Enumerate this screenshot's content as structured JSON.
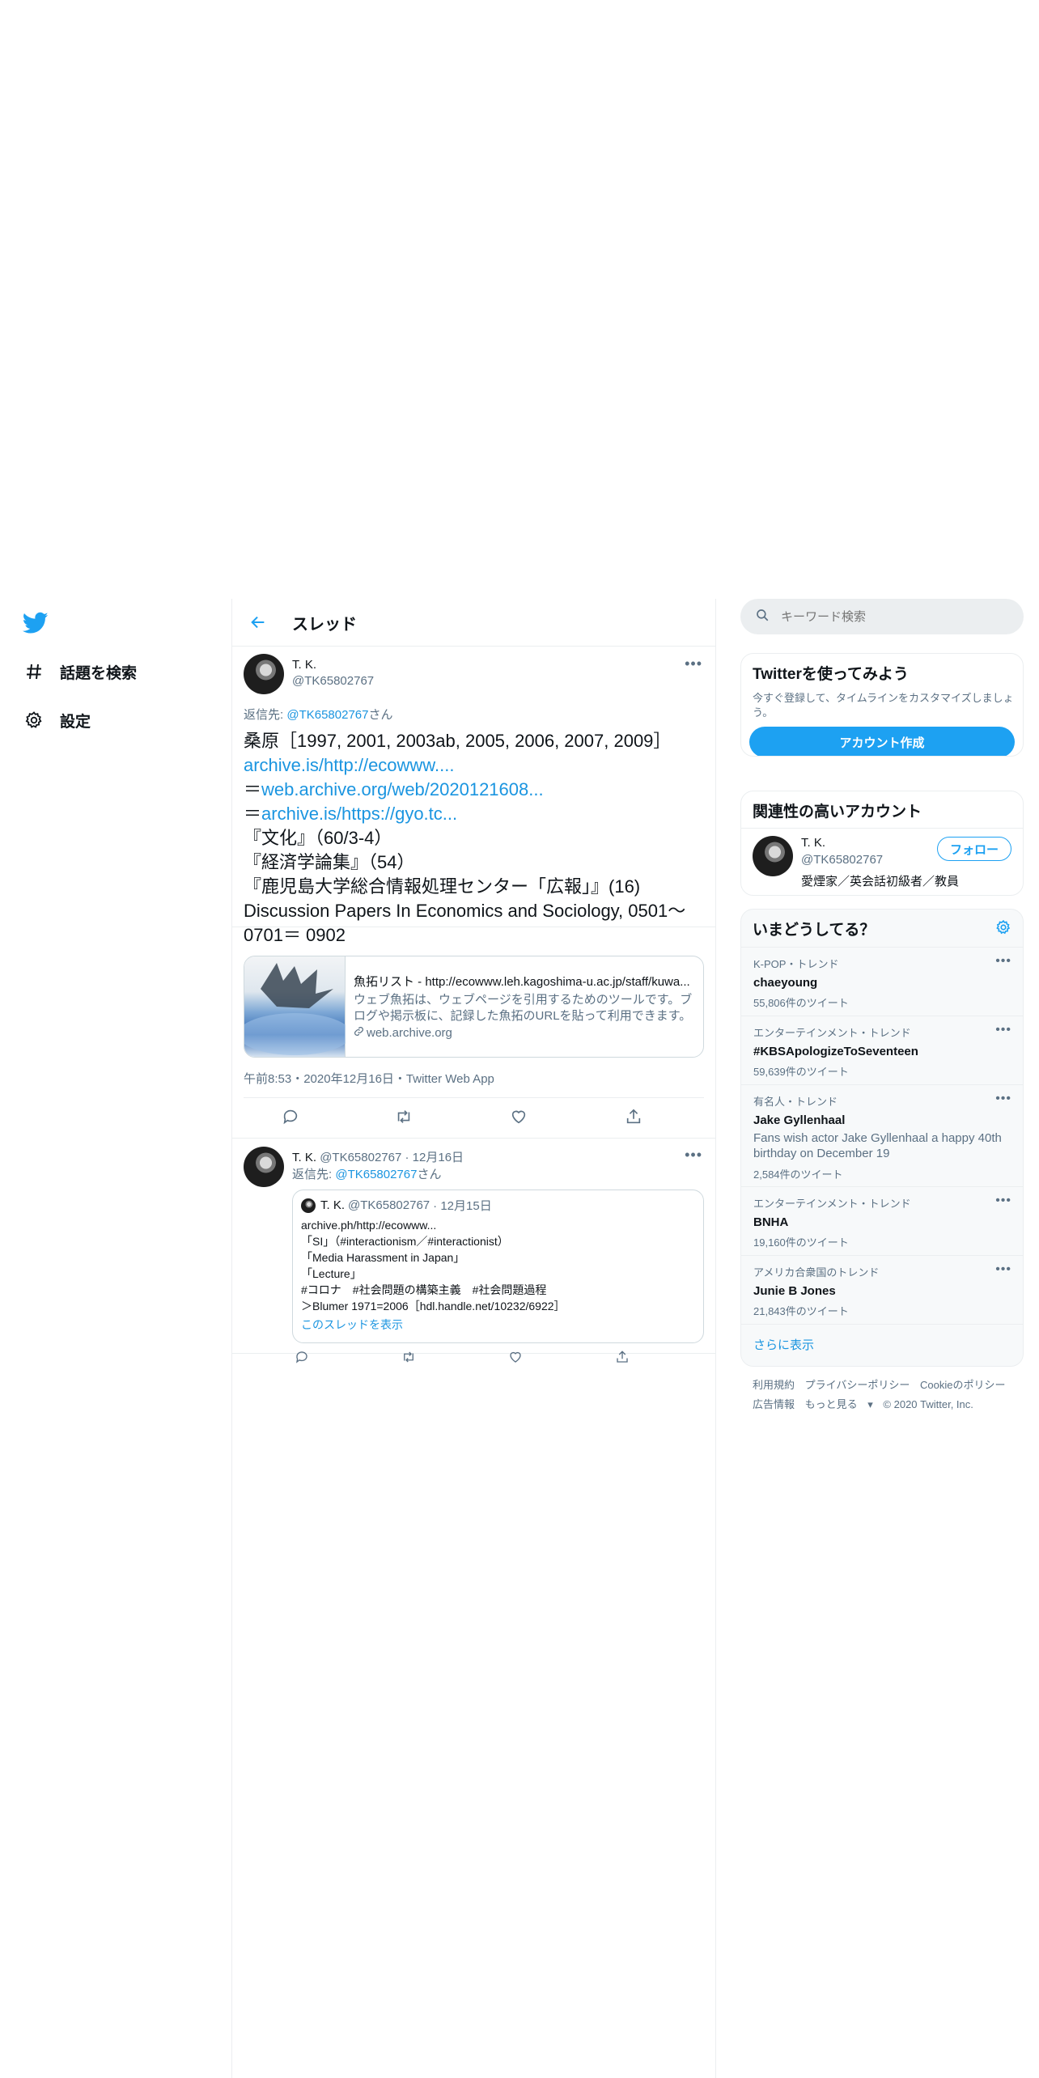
{
  "nav": {
    "explore_label": "話題を検索",
    "settings_label": "設定"
  },
  "header": {
    "title": "スレッド"
  },
  "main_tweet": {
    "name": "T. K.",
    "handle": "@TK65802767",
    "reply_prefix": "返信先: ",
    "reply_handle": "@TK65802767",
    "reply_suffix": "さん",
    "line1": "桑原［1997, 2001, 2003ab, 2005, 2006, 2007, 2009］",
    "link1": "archive.is/http://ecowww....",
    "line2_prefix": "＝",
    "link2": "web.archive.org/web/2020121608...",
    "line3_prefix": "＝",
    "link3": "archive.is/https://gyo.tc...",
    "line4": "『文化』（60/3-4）",
    "line5": "『経済学論集』（54）",
    "line6": "『鹿児島大学総合情報処理センター「広報」』(16)",
    "line7": "Discussion Papers In Economics and Sociology, 0501～ 0701＝ 0902",
    "card": {
      "title": "魚拓リスト - http://ecowww.leh.kagoshima-u.ac.jp/staff/kuwa...",
      "description": "ウェブ魚拓は、ウェブページを引用するためのツールです。ブログや掲示板に、記録した魚拓のURLを貼って利用できます。",
      "domain": "web.archive.org"
    },
    "timestamp": "午前8:53・2020年12月16日・Twitter Web App"
  },
  "reply_tweet": {
    "name": "T. K.",
    "handle": "@TK65802767",
    "date": "· 12月16日",
    "reply_prefix": "返信先: ",
    "reply_handle": "@TK65802767",
    "reply_suffix": "さん",
    "quote": {
      "name": "T. K.",
      "handle": "@TK65802767",
      "date": "· 12月15日",
      "lines": [
        "archive.ph/http://ecowww...",
        "「SI」（#interactionism／#interactionist）",
        "「Media Harassment in Japan」",
        "「Lecture」",
        "#コロナ　#社会問題の構築主義　#社会問題過程",
        "＞Blumer 1971=2006［hdl.handle.net/10232/6922］"
      ],
      "show_thread": "このスレッドを表示"
    }
  },
  "sidebar": {
    "search_placeholder": "キーワード検索",
    "signup": {
      "title": "Twitterを使ってみよう",
      "text": "今すぐ登録して、タイムラインをカスタマイズしましょう。",
      "button": "アカウント作成"
    },
    "related": {
      "title": "関連性の高いアカウント",
      "name": "T. K.",
      "handle": "@TK65802767",
      "bio": "愛煙家／英会話初級者／教員",
      "follow": "フォロー"
    },
    "trends": {
      "title": "いまどうしてる？",
      "items": [
        {
          "category": "K-POP・トレンド",
          "name": "chaeyoung",
          "count": "55,806件のツイート"
        },
        {
          "category": "エンターテインメント・トレンド",
          "name": "#KBSApologizeToSeventeen",
          "count": "59,639件のツイート"
        },
        {
          "category": "有名人・トレンド",
          "name": "Jake Gyllenhaal",
          "description": "Fans wish actor Jake Gyllenhaal a happy 40th birthday on December 19",
          "count": "2,584件のツイート"
        },
        {
          "category": "エンターテインメント・トレンド",
          "name": "BNHA",
          "count": "19,160件のツイート"
        },
        {
          "category": "アメリカ合衆国のトレンド",
          "name": "Junie B Jones",
          "count": "21,843件のツイート"
        }
      ],
      "show_more": "さらに表示"
    },
    "footer": {
      "terms": "利用規約",
      "privacy": "プライバシーポリシー",
      "cookie": "Cookieのポリシー",
      "ads": "広告情報",
      "more": "もっと見る",
      "copyright": "© 2020 Twitter, Inc."
    }
  },
  "colors": {
    "accent": "#1da1f2",
    "link": "#1b95e0",
    "muted": "#5b7083"
  }
}
